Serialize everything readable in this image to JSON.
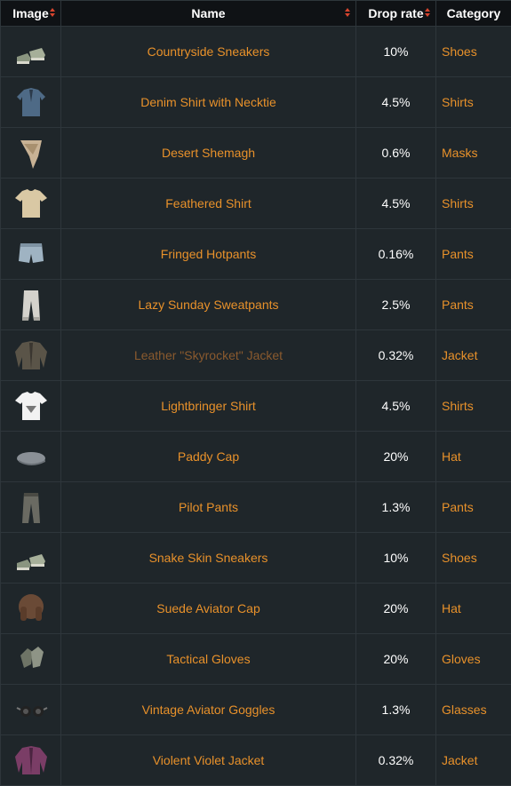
{
  "headers": {
    "image": "Image",
    "name": "Name",
    "drop_rate": "Drop rate",
    "category": "Category"
  },
  "rows": [
    {
      "icon": "sneakers-icon",
      "name": "Countryside Sneakers",
      "rate": "10%",
      "category": "Shoes"
    },
    {
      "icon": "shirt-icon",
      "name": "Denim Shirt with Necktie",
      "rate": "4.5%",
      "category": "Shirts"
    },
    {
      "icon": "shemagh-icon",
      "name": "Desert Shemagh",
      "rate": "0.6%",
      "category": "Masks"
    },
    {
      "icon": "tshirt-icon",
      "name": "Feathered Shirt",
      "rate": "4.5%",
      "category": "Shirts"
    },
    {
      "icon": "shorts-icon",
      "name": "Fringed Hotpants",
      "rate": "0.16%",
      "category": "Pants"
    },
    {
      "icon": "sweatpants-icon",
      "name": "Lazy Sunday Sweatpants",
      "rate": "2.5%",
      "category": "Pants"
    },
    {
      "icon": "jacket-icon",
      "name": "Leather \"Skyrocket\" Jacket",
      "rate": "0.32%",
      "category": "Jacket"
    },
    {
      "icon": "tshirt-icon",
      "name": "Lightbringer Shirt",
      "rate": "4.5%",
      "category": "Shirts"
    },
    {
      "icon": "cap-icon",
      "name": "Paddy Cap",
      "rate": "20%",
      "category": "Hat"
    },
    {
      "icon": "pants-icon",
      "name": "Pilot Pants",
      "rate": "1.3%",
      "category": "Pants"
    },
    {
      "icon": "sneakers-icon",
      "name": "Snake Skin Sneakers",
      "rate": "10%",
      "category": "Shoes"
    },
    {
      "icon": "aviator-cap-icon",
      "name": "Suede Aviator Cap",
      "rate": "20%",
      "category": "Hat"
    },
    {
      "icon": "gloves-icon",
      "name": "Tactical Gloves",
      "rate": "20%",
      "category": "Gloves"
    },
    {
      "icon": "goggles-icon",
      "name": "Vintage Aviator Goggles",
      "rate": "1.3%",
      "category": "Glasses"
    },
    {
      "icon": "jacket-icon",
      "name": "Violent Violet Jacket",
      "rate": "0.32%",
      "category": "Jacket"
    }
  ],
  "colors": {
    "link": "#e8912a",
    "link_visited": "#8a5a2e",
    "sort_arrow": "#d9452e",
    "header_bg": "#0f1215",
    "row_bg": "#1f262a"
  }
}
